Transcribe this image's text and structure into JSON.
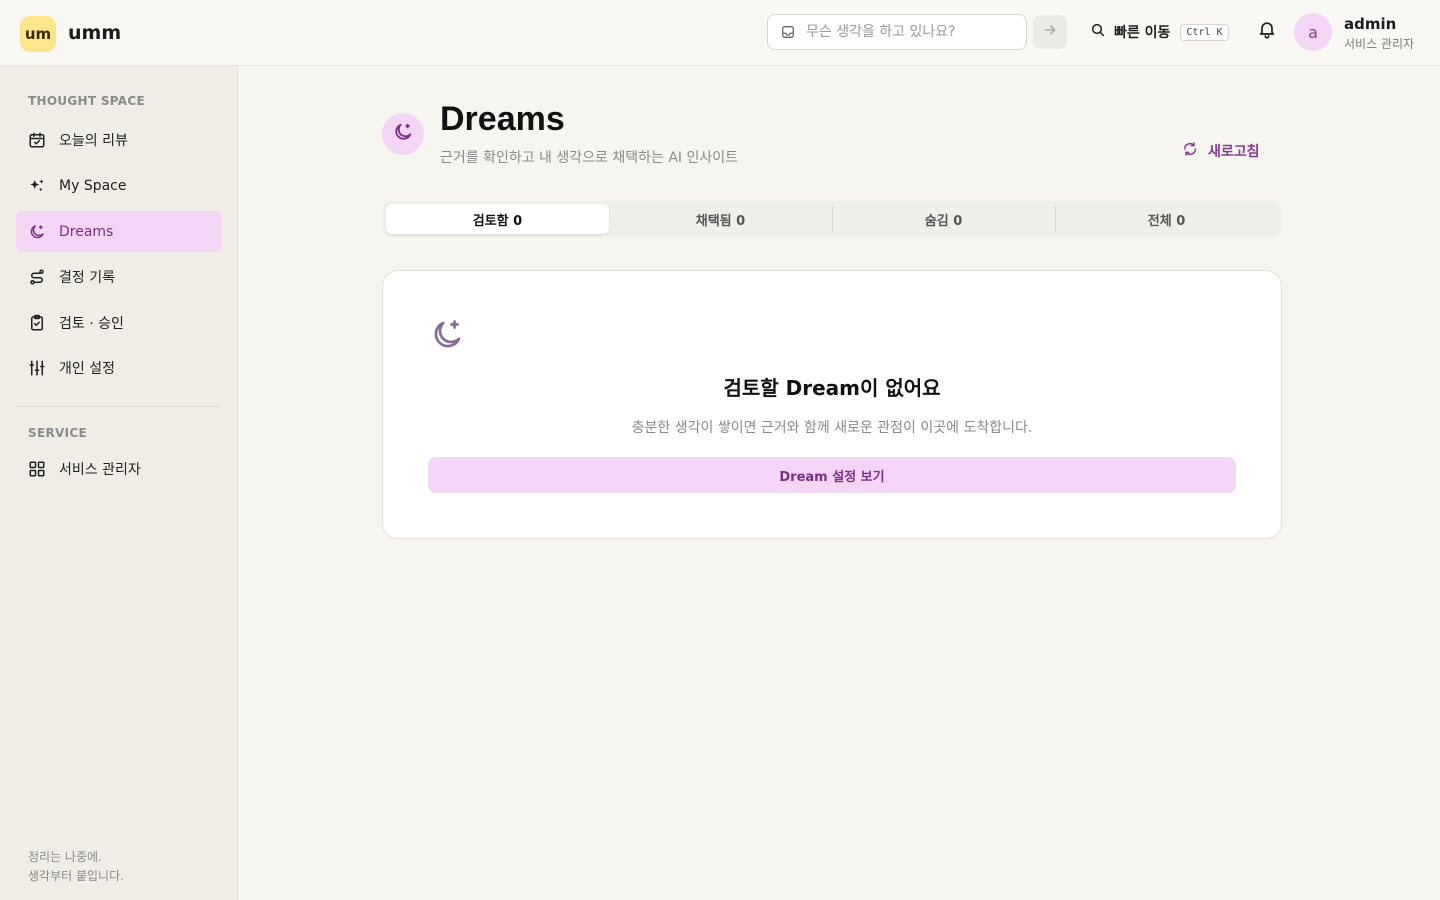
{
  "brand": {
    "badge": "um",
    "name": "umm"
  },
  "topbar": {
    "quick_input_placeholder": "무슨 생각을 하고 있나요?",
    "jump_label": "빠른 이동",
    "jump_shortcut": "Ctrl K",
    "user": {
      "avatar_letter": "a",
      "name": "admin",
      "role": "서비스 관리자"
    }
  },
  "sidebar": {
    "section1_title": "THOUGHT SPACE",
    "items": [
      {
        "label": "오늘의 리뷰",
        "icon": "calendar-check-icon"
      },
      {
        "label": "My Space",
        "icon": "sparkles-icon"
      },
      {
        "label": "Dreams",
        "icon": "moon-icon",
        "active": true
      },
      {
        "label": "결정 기록",
        "icon": "route-icon"
      },
      {
        "label": "검토 · 승인",
        "icon": "clipboard-check-icon"
      },
      {
        "label": "개인 설정",
        "icon": "sliders-icon"
      }
    ],
    "section2_title": "SERVICE",
    "service_items": [
      {
        "label": "서비스 관리자",
        "icon": "grid-icon"
      }
    ],
    "footer_line1": "정리는 나중에.",
    "footer_line2": "생각부터 붙입니다."
  },
  "main": {
    "title": "Dreams",
    "subtitle": "근거를 확인하고 내 생각으로 채택하는 AI 인사이트",
    "refresh_label": "새로고침",
    "tabs": [
      {
        "label": "검토함 0",
        "active": true
      },
      {
        "label": "채택됨 0"
      },
      {
        "label": "숨김 0"
      },
      {
        "label": "전체 0"
      }
    ],
    "empty": {
      "title": "검토할 Dream이 없어요",
      "description": "충분한 생각이 쌓이면 근거와 함께 새로운 관점이 이곳에 도착합니다.",
      "button_label": "Dream 설정 보기"
    }
  },
  "colors": {
    "accent": "#8a3b96",
    "accent_bg": "#f3d6f6",
    "brand_yellow": "#fce58a",
    "sidebar_bg": "#efede6",
    "page_bg": "#f7f5f0"
  }
}
